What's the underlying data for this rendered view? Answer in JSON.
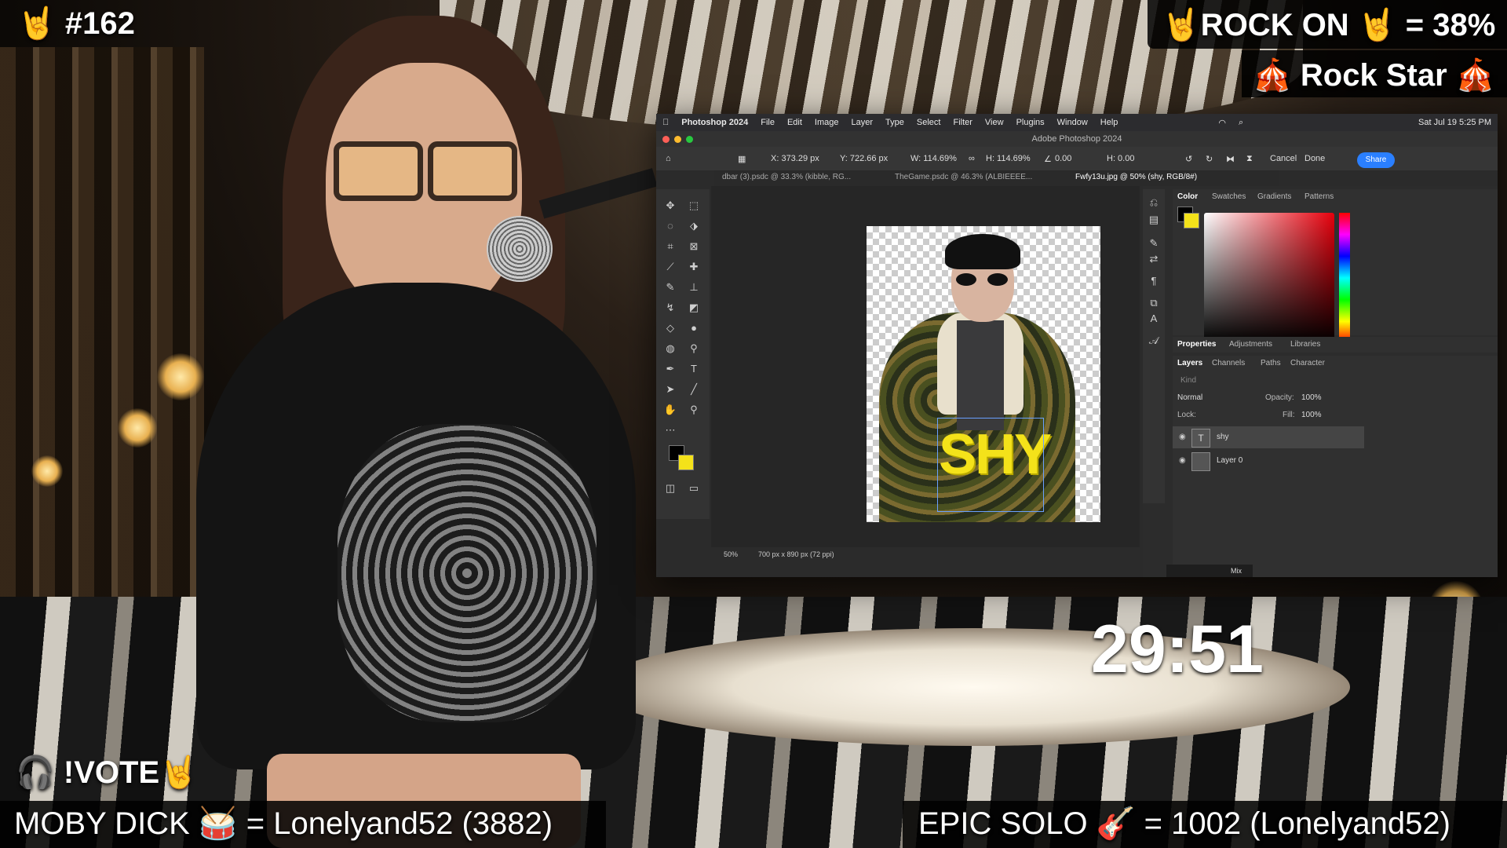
{
  "overlays": {
    "episode": "🤘 #162",
    "rock_on": "🤘ROCK ON 🤘 = 38%",
    "rock_star": "🎪 Rock Star 🎪",
    "vote": "🎧 !VOTE🤘",
    "moby_dick": "MOBY DICK 🥁 = Lonelyand52 (3882)",
    "epic_solo": "EPIC SOLO 🎸 =  1002 (Lonelyand52)",
    "timer": "29:51"
  },
  "mac_menu": {
    "app": "Photoshop 2024",
    "items": [
      "File",
      "Edit",
      "Image",
      "Layer",
      "Type",
      "Select",
      "Filter",
      "View",
      "Plugins",
      "Window",
      "Help"
    ],
    "clock": "Sat Jul 19  5:25 PM"
  },
  "window": {
    "title": "Adobe Photoshop 2024"
  },
  "options": {
    "x": "X: 373.29 px",
    "y": "Y: 722.66 px",
    "w": "W: 114.69%",
    "h": "H: 114.69%",
    "angle": "0.00",
    "hskew": "H: 0.00",
    "cancel": "Cancel",
    "done": "Done",
    "share": "Share"
  },
  "tabs": [
    {
      "label": "dbar (3).psdc @ 33.3% (kibble, RG..."
    },
    {
      "label": "TheGame.psdc @ 46.3% (ALBIEEEE..."
    },
    {
      "label": "Fwfy13u.jpg @ 50% (shy, RGB/8#)"
    }
  ],
  "canvas": {
    "text_layer": "SHY"
  },
  "status": {
    "zoom": "50%",
    "doc_size": "700 px x 890 px (72 ppi)"
  },
  "color_panel": {
    "tabs": [
      "Color",
      "Swatches",
      "Gradients",
      "Patterns"
    ]
  },
  "properties_panel": {
    "tabs": [
      "Properties",
      "Adjustments",
      "Libraries"
    ]
  },
  "layers_panel": {
    "tabs": [
      "Layers",
      "Channels",
      "Paths",
      "Character"
    ],
    "search_placeholder": "Kind",
    "blend_mode": "Normal",
    "opacity_label": "Opacity:",
    "opacity": "100%",
    "lock_label": "Lock:",
    "fill_label": "Fill:",
    "fill": "100%",
    "layers": [
      {
        "name": "shy",
        "thumb": "T"
      },
      {
        "name": "Layer 0",
        "thumb": ""
      }
    ]
  },
  "taskbar": {
    "mix": "Mix"
  },
  "colors": {
    "foreground": "#000000",
    "background": "#f4e21a",
    "accent": "#2a7fff"
  }
}
